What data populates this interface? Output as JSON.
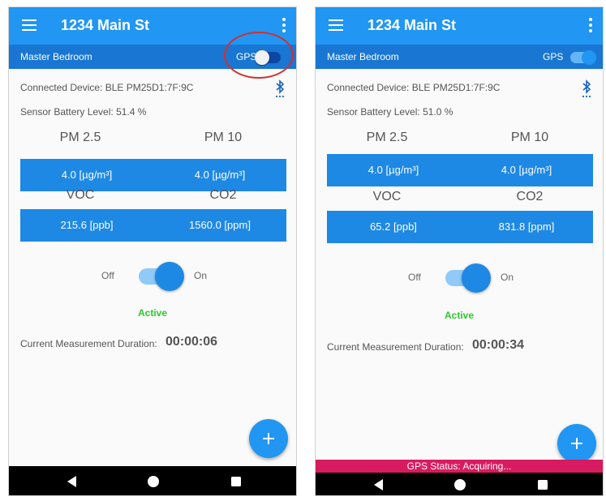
{
  "left": {
    "app_title": "1234 Main St",
    "room_name": "Master Bedroom",
    "gps_label": "GPS",
    "gps_state": "off",
    "device_label": "Connected Device:",
    "device_value": "BLE PM25D1:7F:9C",
    "battery_label": "Sensor Battery Level:",
    "battery_value": "51.4 %",
    "pm25_label": "PM 2.5",
    "pm10_label": "PM 10",
    "pm25_value": "4.0 [µg/m³]",
    "pm10_value": "4.0 [µg/m³]",
    "voc_label": "VOC",
    "co2_label": "CO2",
    "voc_value": "215.6 [ppb]",
    "co2_value": "1560.0 [ppm]",
    "off_label": "Off",
    "on_label": "On",
    "status": "Active",
    "duration_label": "Current Measurement Duration:",
    "duration_value": "00:00:06"
  },
  "right": {
    "app_title": "1234 Main St",
    "room_name": "Master Bedroom",
    "gps_label": "GPS",
    "gps_state": "on",
    "device_label": "Connected Device:",
    "device_value": "BLE PM25D1:7F:9C",
    "battery_label": "Sensor Battery Level:",
    "battery_value": "51.0 %",
    "pm25_label": "PM 2.5",
    "pm10_label": "PM 10",
    "pm25_value": "4.0 [µg/m³]",
    "pm10_value": "4.0 [µg/m³]",
    "voc_label": "VOC",
    "co2_label": "CO2",
    "voc_value": "65.2 [ppb]",
    "co2_value": "831.8 [ppm]",
    "off_label": "Off",
    "on_label": "On",
    "status": "Active",
    "duration_label": "Current Measurement Duration:",
    "duration_value": "00:00:34",
    "gps_status": "GPS Status: Acquiring..."
  },
  "icons": {
    "menu": "hamburger-menu-icon",
    "overflow": "more-vert-icon",
    "bluetooth": "bluetooth-searching-icon",
    "add": "add-icon",
    "back": "nav-back-icon",
    "home": "nav-home-icon",
    "recents": "nav-recents-icon"
  },
  "colors": {
    "appbar": "#2196f3",
    "subbar": "#1976d2",
    "value_bar": "#1e88e5",
    "active_text": "#2dc82d",
    "gps_status_bar": "#d81b60",
    "highlight_ring": "#d32f2f"
  }
}
